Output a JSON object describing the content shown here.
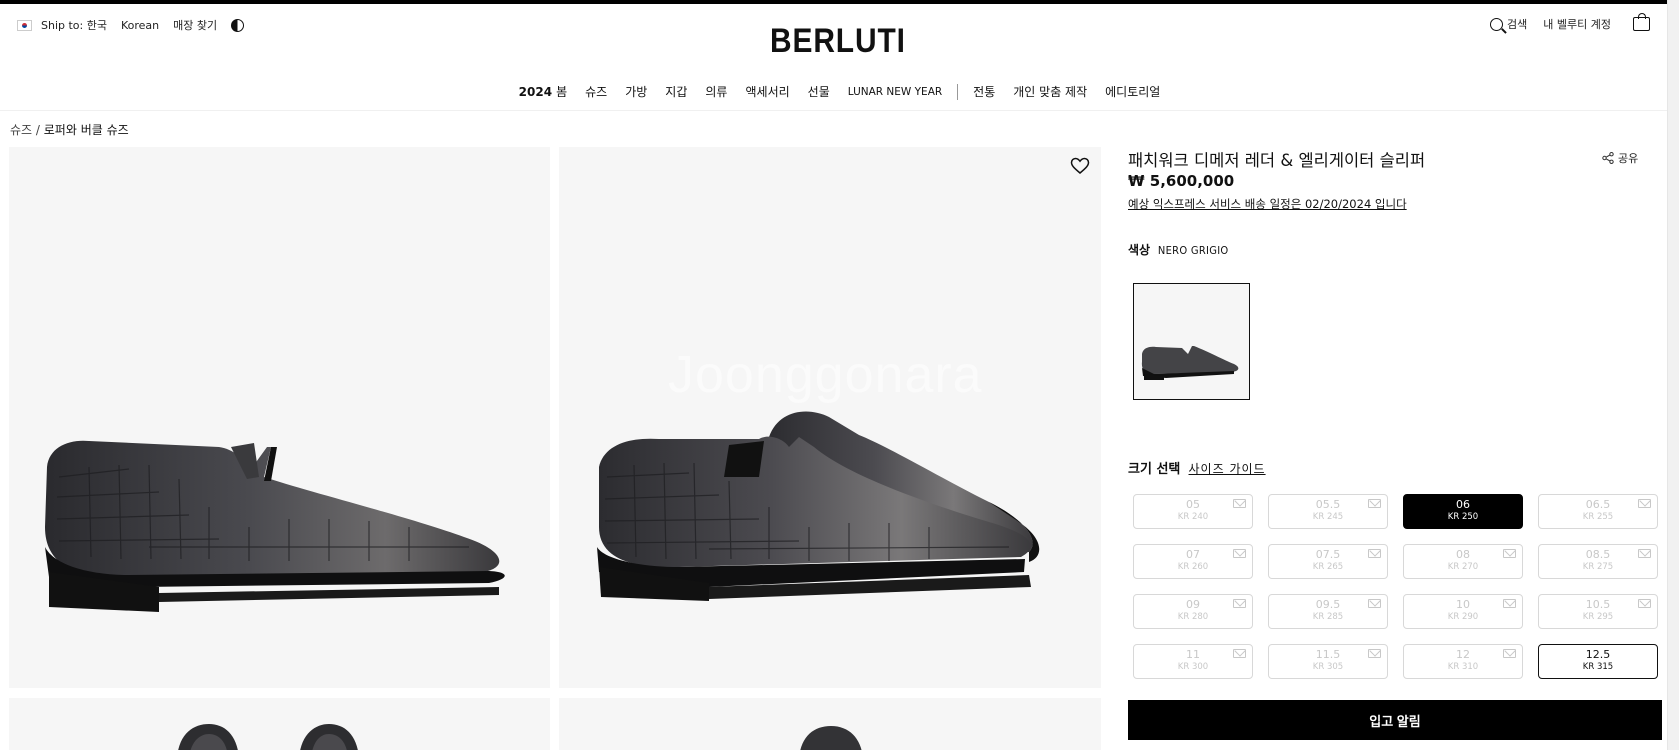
{
  "header": {
    "ship_to": "Ship to: 한국",
    "language": "Korean",
    "store_finder": "매장 찾기",
    "logo": "BERLUTI",
    "search_label": "검색",
    "account_label": "내 벨루티 계정"
  },
  "nav": {
    "season_year": "2024",
    "season": "봄",
    "items": [
      "슈즈",
      "가방",
      "지갑",
      "의류",
      "액세서리",
      "선물",
      "LUNAR NEW YEAR"
    ],
    "items_after": [
      "전통",
      "개인 맞춤 제작",
      "에디토리얼"
    ]
  },
  "breadcrumb": {
    "parent": "슈즈",
    "separator": " / ",
    "current": "로퍼와 버클 슈즈"
  },
  "gallery": {
    "watermark": "Joonggonara"
  },
  "product": {
    "title": "패치워크 디메저 레더 & 엘리게이터 슬리퍼",
    "share_label": "공유",
    "price": "₩ 5,600,000",
    "delivery": "예상 익스프레스 서비스 배송 일정은 02/20/2024 입니다",
    "color_label": "색상",
    "color_value": "NERO GRIGIO",
    "size_label": "크기 선택",
    "size_guide": "사이즈 가이드",
    "sizes": [
      {
        "size": "05",
        "kr": "KR 240"
      },
      {
        "size": "05.5",
        "kr": "KR 245"
      },
      {
        "size": "06",
        "kr": "KR 250"
      },
      {
        "size": "06.5",
        "kr": "KR 255"
      },
      {
        "size": "07",
        "kr": "KR 260"
      },
      {
        "size": "07.5",
        "kr": "KR 265"
      },
      {
        "size": "08",
        "kr": "KR 270"
      },
      {
        "size": "08.5",
        "kr": "KR 275"
      },
      {
        "size": "09",
        "kr": "KR 280"
      },
      {
        "size": "09.5",
        "kr": "KR 285"
      },
      {
        "size": "10",
        "kr": "KR 290"
      },
      {
        "size": "10.5",
        "kr": "KR 295"
      },
      {
        "size": "11",
        "kr": "KR 300"
      },
      {
        "size": "11.5",
        "kr": "KR 305"
      },
      {
        "size": "12",
        "kr": "KR 310"
      },
      {
        "size": "12.5",
        "kr": "KR 315"
      }
    ],
    "notify_button": "입고 알림"
  }
}
